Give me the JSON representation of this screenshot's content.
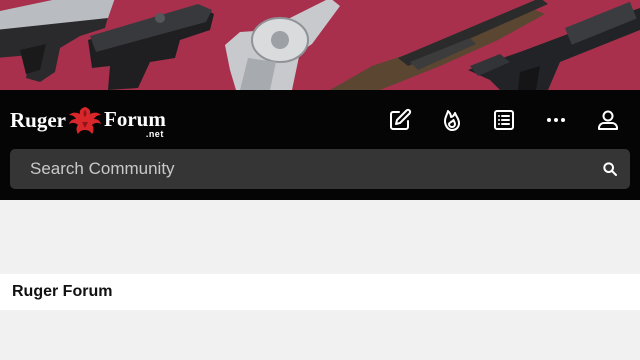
{
  "colors": {
    "banner_bg": "#a8304c",
    "topbar_bg": "#050505",
    "search_bg": "#353535",
    "page_bg": "#f1f1f1",
    "logo_eagle": "#d9262b"
  },
  "banner": {
    "image": "firearms-banner"
  },
  "logo": {
    "word_left": "Ruger",
    "word_right": "Forum",
    "suffix": ".net"
  },
  "nav": {
    "icons": [
      "compose-icon",
      "trending-flame-icon",
      "list-icon",
      "more-dots-icon",
      "user-profile-icon"
    ]
  },
  "search": {
    "placeholder": "Search Community",
    "value": ""
  },
  "breadcrumb": {
    "title": "Ruger Forum"
  }
}
